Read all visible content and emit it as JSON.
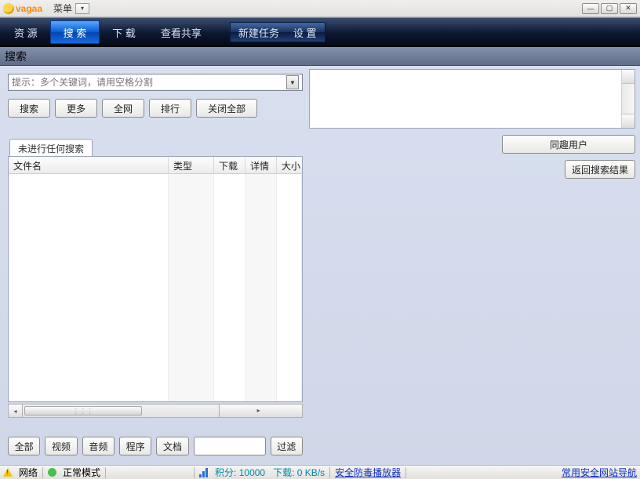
{
  "title": {
    "app_name": "vagaa",
    "menu_label": "菜单"
  },
  "nav": {
    "items": [
      "资 源",
      "搜 索",
      "下 载",
      "查看共享"
    ],
    "active_index": 1,
    "special": {
      "new_task": "新建任务",
      "settings": "设 置"
    }
  },
  "subtitle": "搜索",
  "search": {
    "placeholder": "提示：多个关键词，请用空格分割",
    "buttons": {
      "search": "搜索",
      "more": "更多",
      "allnet": "全网",
      "rank": "排行",
      "close_all": "关闭全部"
    }
  },
  "tab": {
    "label": "未进行任何搜索"
  },
  "columns": {
    "filename": "文件名",
    "type": "类型",
    "download": "下载",
    "detail": "详情",
    "size": "大小"
  },
  "filters": {
    "all": "全部",
    "video": "视频",
    "audio": "音频",
    "program": "程序",
    "document": "文档",
    "filter": "过滤"
  },
  "side": {
    "same_interest": "同趣用户",
    "back_results": "返回搜索结果"
  },
  "status": {
    "network": "网络",
    "mode": "正常模式",
    "score_label": "积分:",
    "score_value": "10000",
    "dl_label": "下载:",
    "dl_value": "0 KB/s",
    "link_player": "安全防毒播放器",
    "link_nav": "常用安全网站导航"
  }
}
